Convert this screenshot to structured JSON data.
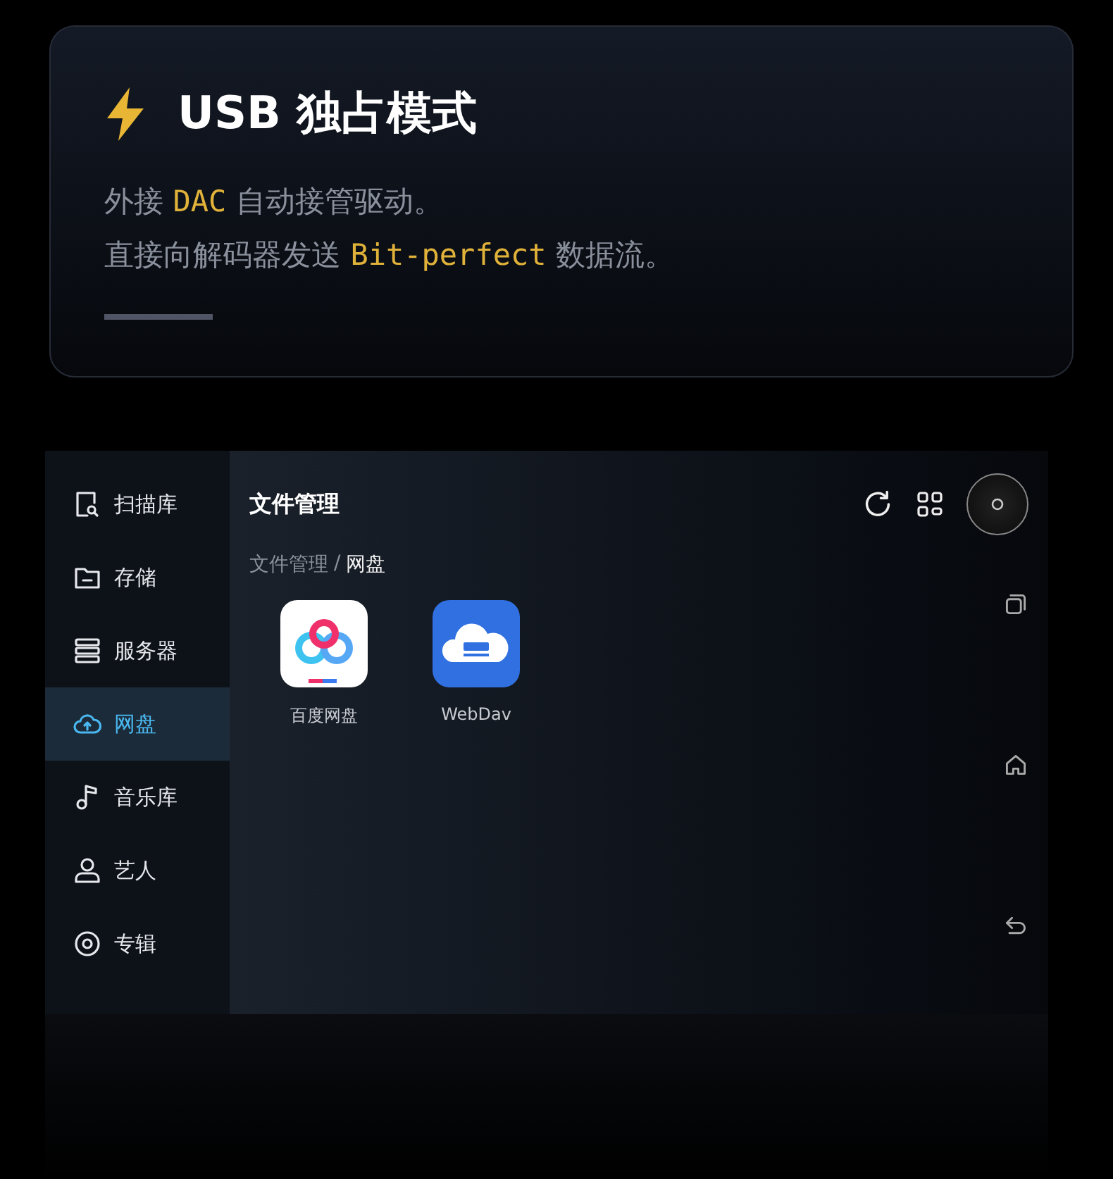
{
  "feature_card": {
    "title": "USB 独占模式",
    "lines": [
      "外接 **DAC** 自动接管驱动。",
      "直接向解码器发送 **Bit-perfect** 数据流。"
    ]
  },
  "screen": {
    "sidebar": {
      "items": [
        {
          "label": "扫描库",
          "selected": false
        },
        {
          "label": "存储",
          "selected": false
        },
        {
          "label": "服务器",
          "selected": false
        },
        {
          "label": "网盘",
          "selected": true
        },
        {
          "label": "音乐库",
          "selected": false
        },
        {
          "label": "艺人",
          "selected": false
        },
        {
          "label": "专辑",
          "selected": false
        }
      ]
    },
    "header": {
      "title": "文件管理",
      "breadcrumb": [
        "文件管理",
        "网盘"
      ],
      "breadcrumb_separator": "/"
    },
    "apps": [
      {
        "label": "百度网盘",
        "kind": "baidu"
      },
      {
        "label": "WebDav",
        "kind": "webdav"
      }
    ]
  }
}
